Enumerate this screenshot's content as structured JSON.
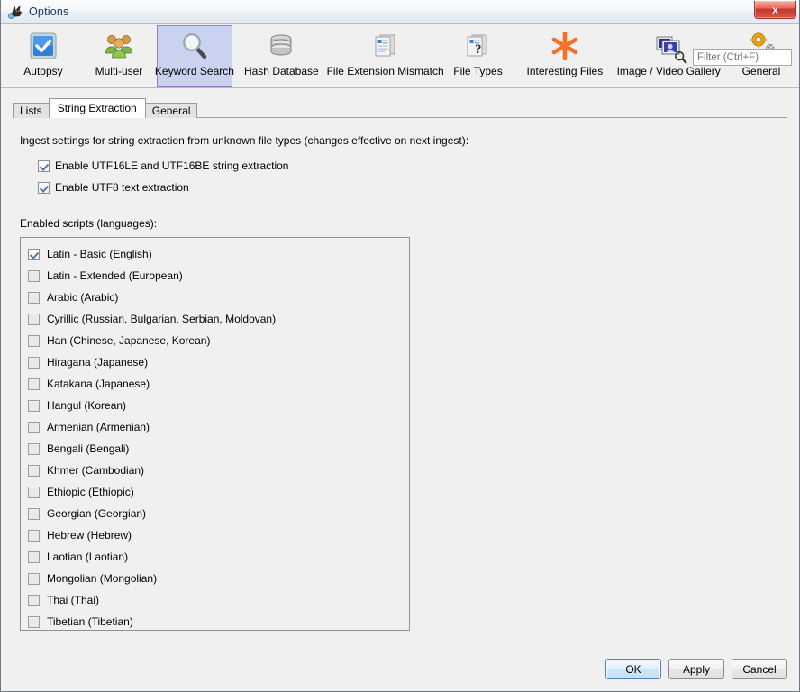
{
  "window": {
    "title": "Options",
    "title_icon": "autopsy-dog-icon",
    "close_label": "x"
  },
  "toolbar": {
    "items": [
      {
        "label": "Autopsy",
        "icon": "autopsy-checkbox-icon",
        "selected": false
      },
      {
        "label": "Multi-user",
        "icon": "multi-user-people-icon",
        "selected": false
      },
      {
        "label": "Keyword Search",
        "icon": "magnifier-icon",
        "selected": true
      },
      {
        "label": "Hash Database",
        "icon": "database-icon",
        "selected": false
      },
      {
        "label": "File Extension Mismatch",
        "icon": "documents-icon",
        "selected": false
      },
      {
        "label": "File Types",
        "icon": "document-question-icon",
        "selected": false
      },
      {
        "label": "Interesting Files",
        "icon": "asterisk-icon",
        "selected": false
      },
      {
        "label": "Image / Video Gallery",
        "icon": "photo-stack-icon",
        "selected": false
      },
      {
        "label": "General",
        "icon": "gear-wrench-icon",
        "selected": false
      }
    ],
    "filter": {
      "icon": "search-icon",
      "value": "",
      "placeholder": "Filter (Ctrl+F)"
    }
  },
  "tabs": [
    {
      "label": "Lists",
      "active": false
    },
    {
      "label": "String Extraction",
      "active": true
    },
    {
      "label": "General",
      "active": false
    }
  ],
  "panel": {
    "ingest_hint": "Ingest settings for string extraction from unknown file types (changes effective on next ingest):",
    "options": [
      {
        "label": "Enable UTF16LE and UTF16BE string extraction",
        "checked": true
      },
      {
        "label": "Enable UTF8 text extraction",
        "checked": true
      }
    ],
    "scripts_label": "Enabled scripts (languages):",
    "scripts": [
      {
        "label": "Latin - Basic (English)",
        "checked": true
      },
      {
        "label": "Latin - Extended (European)",
        "checked": false
      },
      {
        "label": "Arabic (Arabic)",
        "checked": false
      },
      {
        "label": "Cyrillic (Russian, Bulgarian, Serbian, Moldovan)",
        "checked": false
      },
      {
        "label": "Han (Chinese, Japanese, Korean)",
        "checked": false
      },
      {
        "label": "Hiragana (Japanese)",
        "checked": false
      },
      {
        "label": "Katakana (Japanese)",
        "checked": false
      },
      {
        "label": "Hangul (Korean)",
        "checked": false
      },
      {
        "label": "Armenian (Armenian)",
        "checked": false
      },
      {
        "label": "Bengali (Bengali)",
        "checked": false
      },
      {
        "label": "Khmer (Cambodian)",
        "checked": false
      },
      {
        "label": "Ethiopic (Ethiopic)",
        "checked": false
      },
      {
        "label": "Georgian (Georgian)",
        "checked": false
      },
      {
        "label": "Hebrew (Hebrew)",
        "checked": false
      },
      {
        "label": "Laotian (Laotian)",
        "checked": false
      },
      {
        "label": "Mongolian (Mongolian)",
        "checked": false
      },
      {
        "label": "Thai (Thai)",
        "checked": false
      },
      {
        "label": "Tibetian (Tibetian)",
        "checked": false
      }
    ]
  },
  "footer": {
    "ok_label": "OK",
    "apply_label": "Apply",
    "cancel_label": "Cancel"
  },
  "colors": {
    "selected_toolbar_bg": "#c9d2ee",
    "selected_toolbar_border": "#9a7cc0",
    "title_text": "#1c3a63",
    "window_bg": "#f0f0f0",
    "close_button": "#c5392c",
    "primary_button_border": "#4f82c0"
  }
}
